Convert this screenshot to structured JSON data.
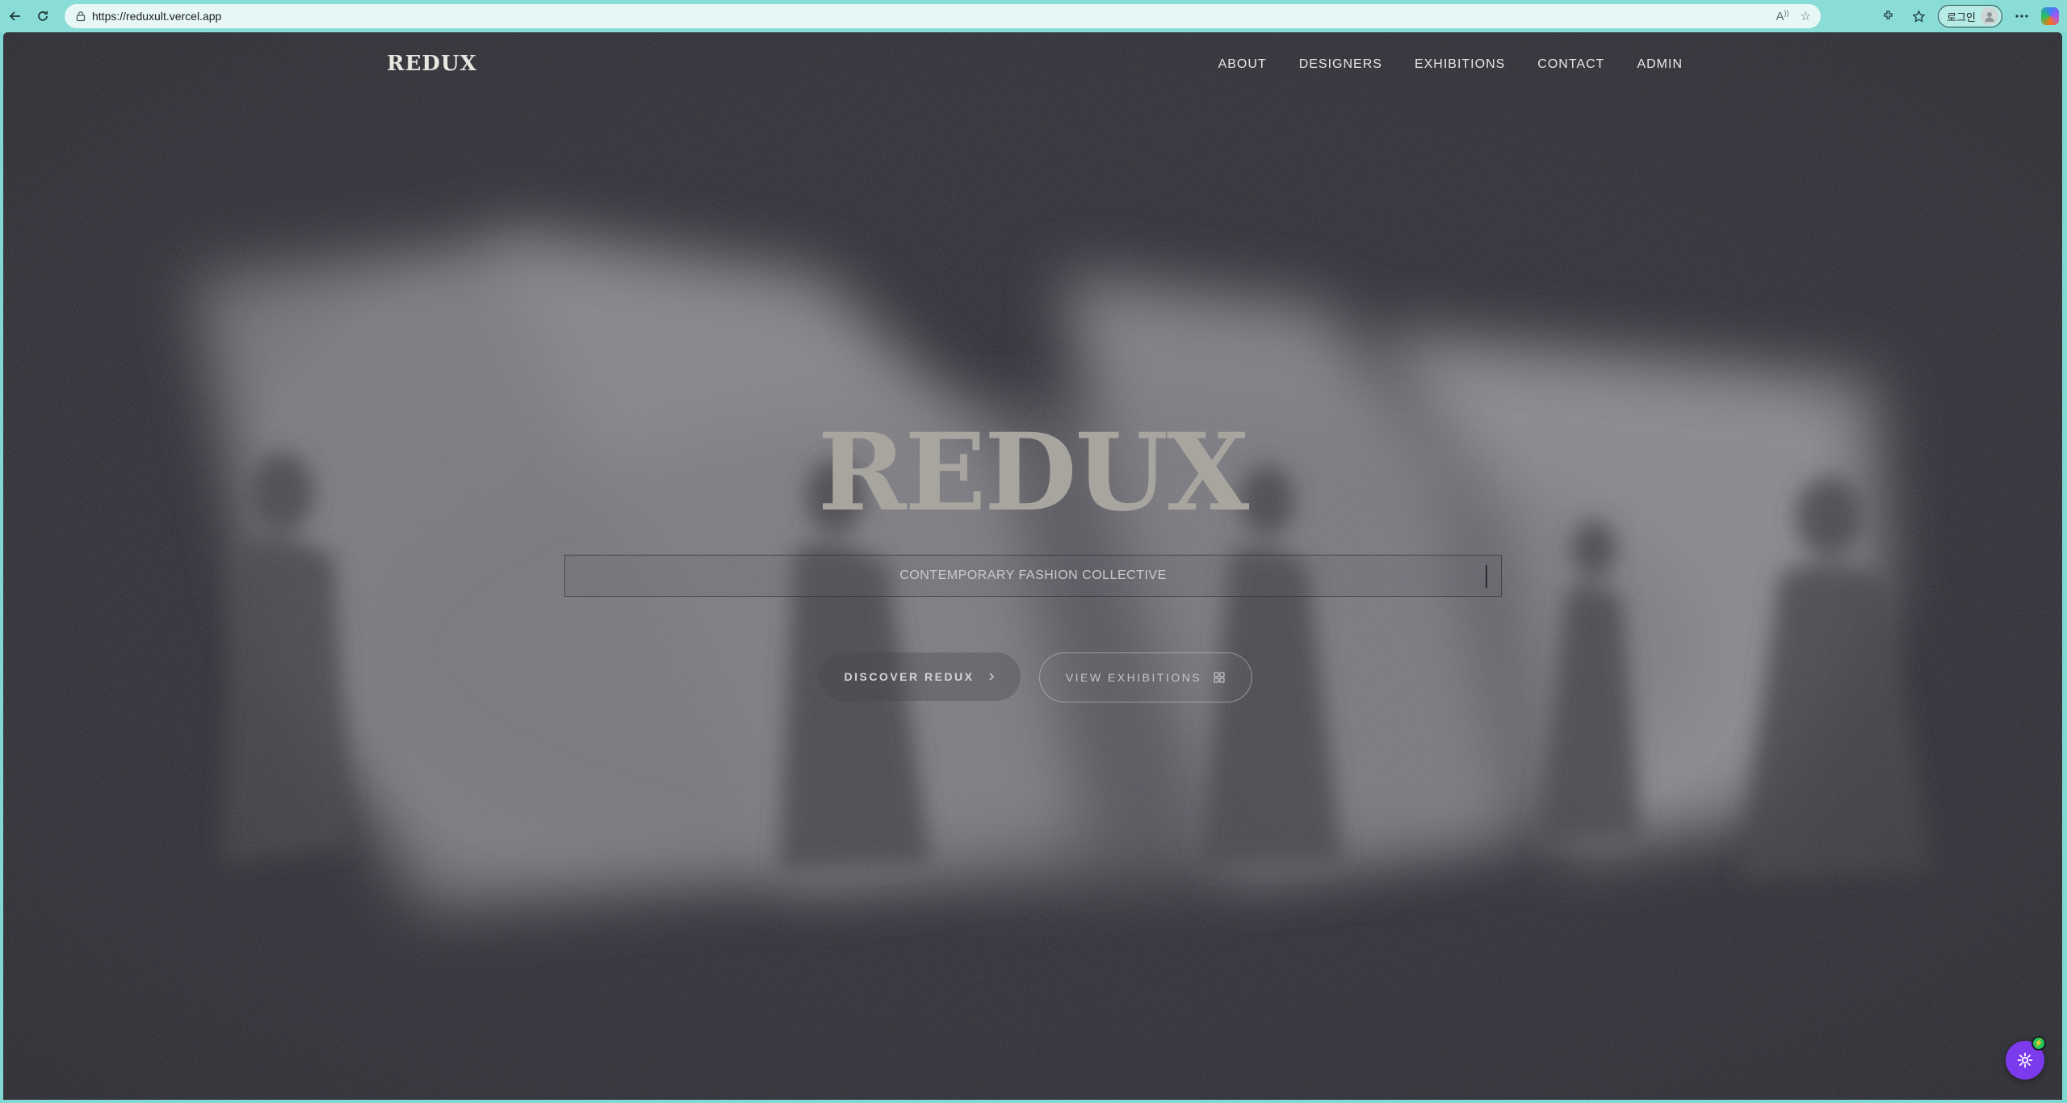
{
  "browser": {
    "url": "https://reduxult.vercel.app",
    "profile_label": "로그인"
  },
  "site": {
    "logo": "REDUX",
    "nav": [
      "ABOUT",
      "DESIGNERS",
      "EXHIBITIONS",
      "CONTACT",
      "ADMIN"
    ]
  },
  "hero": {
    "title": "REDUX",
    "tagline": "CONTEMPORARY FASHION COLLECTIVE",
    "primary_cta": "DISCOVER REDUX",
    "secondary_cta": "VIEW EXHIBITIONS"
  },
  "colors": {
    "background": "#25252d",
    "accent": "#7c3aed",
    "browser_chrome": "#8adcd6"
  },
  "icons": [
    "back-arrow-icon",
    "refresh-icon",
    "lock-icon",
    "read-aloud-icon",
    "star-icon",
    "extensions-icon",
    "favorites-icon",
    "more-icon",
    "copilot-icon",
    "chevron-right-icon",
    "grid-icon",
    "gear-icon"
  ]
}
